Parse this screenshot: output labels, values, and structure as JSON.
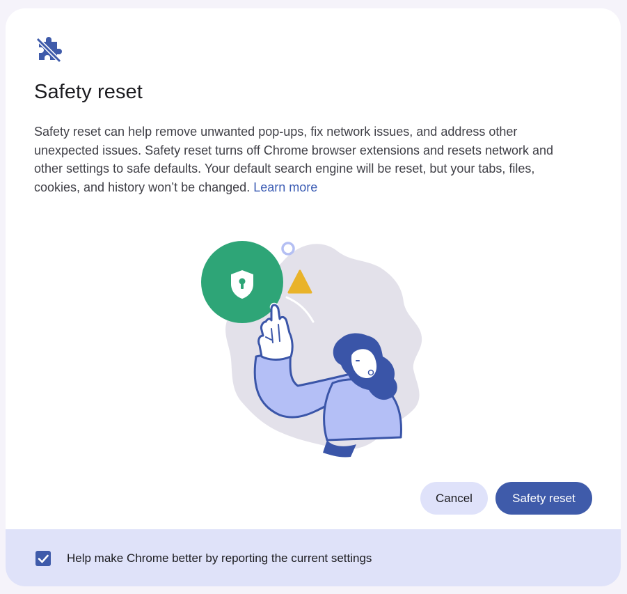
{
  "dialog": {
    "icon": "extension-off-icon",
    "title": "Safety reset",
    "body": "Safety reset can help remove unwanted pop-ups, fix network issues, and address other unexpected issues. Safety reset turns off Chrome browser extensions and resets network and other settings to safe defaults. Your default search engine will be reset, but your tabs, files, cookies, and history won’t be changed.",
    "learn_more": "Learn more",
    "illustration": "person-pointing-at-shield-illustration"
  },
  "buttons": {
    "cancel": "Cancel",
    "confirm": "Safety reset"
  },
  "footer": {
    "checkbox_checked": true,
    "checkbox_label": "Help make Chrome better by reporting the current settings"
  },
  "colors": {
    "accent": "#3f5baa",
    "tonal": "#dfe2fa",
    "footer_bg": "#dfe2f9",
    "shield_green": "#2ea577",
    "warning_yellow": "#e9b32a"
  }
}
